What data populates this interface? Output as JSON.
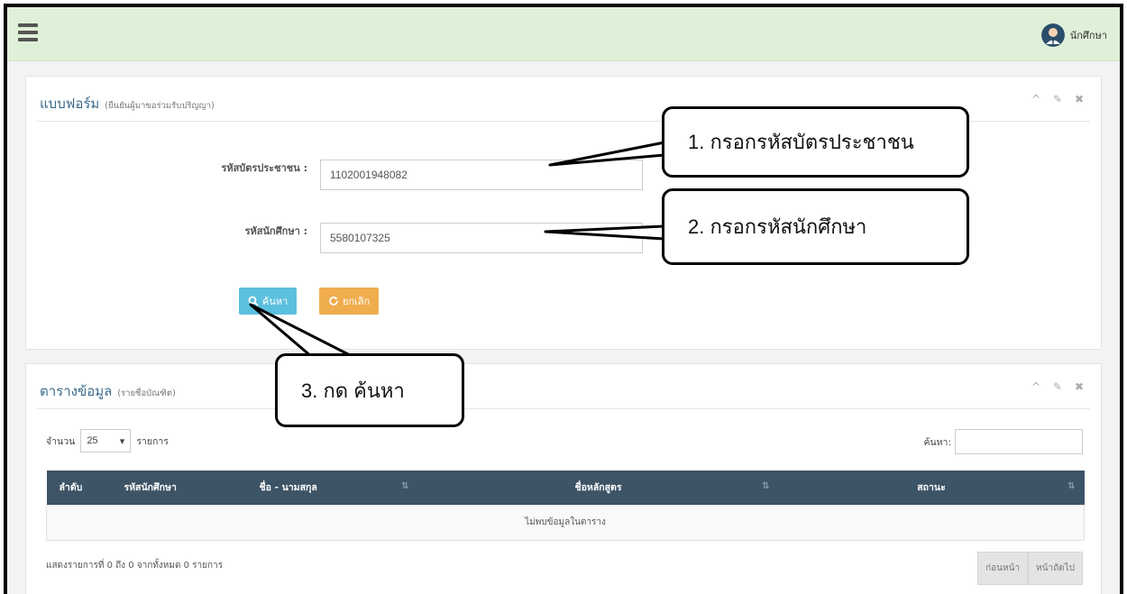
{
  "header": {
    "menu_icon": "hamburger-icon",
    "user_name": "นักศึกษา",
    "avatar_icon": "user-avatar-icon"
  },
  "form_panel": {
    "title": "แบบฟอร์ม",
    "subtitle": "(ยืนยันผู้มาขอร่วมรับปริญญา)",
    "tools": [
      "^",
      "✎",
      "✖"
    ],
    "id_card_label": "รหัสบัตรประชาชน :",
    "id_card_value": "1102001948082",
    "student_id_label": "รหัสนักศึกษา :",
    "student_id_value": "5580107325",
    "search_button": "ค้นหา",
    "cancel_button": "ยกเลิก"
  },
  "table_panel": {
    "title": "ตารางข้อมูล",
    "subtitle": "(รายชื่อบัณฑิต)",
    "tools": [
      "^",
      "✎",
      "✖"
    ],
    "length_prefix": "จำนวน",
    "length_value": "25",
    "length_suffix": "รายการ",
    "search_label": "ค้นหา:",
    "columns": [
      "ลำดับ",
      "รหัสนักศึกษา",
      "ชื่อ - นามสกุล",
      "ชื่อหลักสูตร",
      "สถานะ"
    ],
    "empty_message": "ไม่พบข้อมูลในตาราง",
    "info": "แสดงรายการที่ 0 ถึง 0 จากทั้งหมด 0 รายการ",
    "prev": "ก่อนหน้า",
    "next": "หน้าถัดไป"
  },
  "callouts": {
    "step1": "1. กรอกรหัสบัตรประชาชน",
    "step2": "2. กรอกรหัสนักศึกษา",
    "step3": "3. กด  ค้นหา"
  },
  "colors": {
    "topbar": "#dff0d8",
    "table_header": "#3d5366",
    "search_button": "#5bc0de",
    "cancel_button": "#f0ad4e",
    "panel_title": "#3b6b8c"
  }
}
